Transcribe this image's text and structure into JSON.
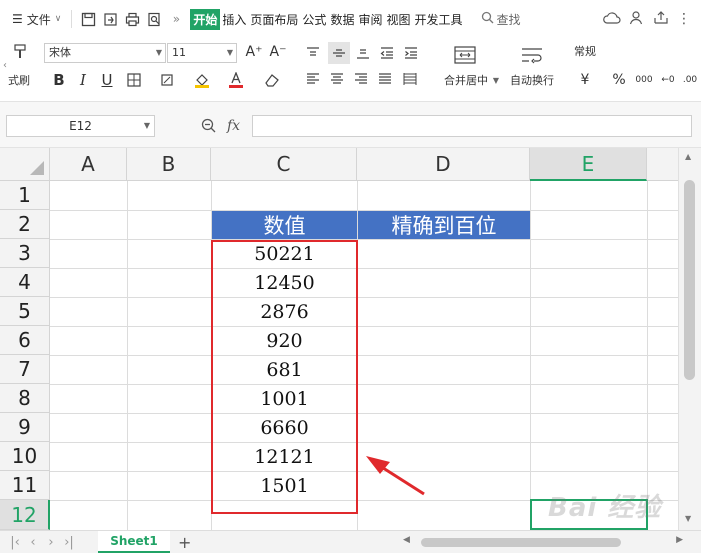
{
  "menubar": {
    "file_label": "文件",
    "tabs": [
      {
        "label": "开始",
        "active": true
      },
      {
        "label": "插入",
        "active": false
      },
      {
        "label": "页面布局",
        "active": false
      },
      {
        "label": "公式",
        "active": false
      },
      {
        "label": "数据",
        "active": false
      },
      {
        "label": "审阅",
        "active": false
      },
      {
        "label": "视图",
        "active": false
      },
      {
        "label": "开发工具",
        "active": false
      }
    ],
    "search_label": "查找"
  },
  "ribbon": {
    "format_brush_label": "式刷",
    "font_name": "宋体",
    "font_size": "11",
    "merge_label": "合并居中",
    "wrap_label": "自动换行",
    "number_format": "常规"
  },
  "formula_bar": {
    "cell_ref": "E12",
    "fx_label": "fx",
    "formula_value": ""
  },
  "grid": {
    "columns": [
      "A",
      "B",
      "C",
      "D",
      "E"
    ],
    "active_column": "E",
    "rows": [
      "1",
      "2",
      "3",
      "4",
      "5",
      "6",
      "7",
      "8",
      "9",
      "10",
      "11",
      "12"
    ],
    "active_row": "12",
    "header_c2": "数值",
    "header_d2": "精确到百位",
    "values": [
      "50221",
      "12450",
      "2876",
      "920",
      "681",
      "1001",
      "6660",
      "12121",
      "1501"
    ]
  },
  "sheets": [
    {
      "label": "Sheet1",
      "active": true
    }
  ],
  "watermark_text": "Bai 经验",
  "colors": {
    "accent": "#21a366",
    "header_fill": "#4472c4",
    "highlight": "#e0292c"
  }
}
